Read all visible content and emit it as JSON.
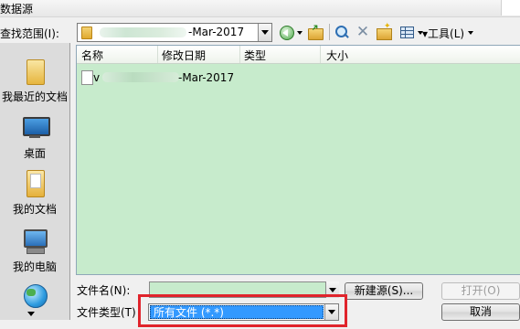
{
  "window": {
    "title": "数据源"
  },
  "lookin": {
    "label": "查找范围(I):",
    "path_suffix": "-Mar-2017"
  },
  "toolbar": {
    "tools_label": "工具(L)",
    "icons": [
      "back-icon",
      "up-folder-icon",
      "search-web-icon",
      "delete-icon",
      "new-folder-icon",
      "view-menu-icon"
    ]
  },
  "places": [
    {
      "label": "我最近的文档",
      "icon": "recent-documents-icon"
    },
    {
      "label": "桌面",
      "icon": "desktop-icon"
    },
    {
      "label": "我的文档",
      "icon": "my-documents-icon"
    },
    {
      "label": "我的电脑",
      "icon": "my-computer-icon"
    },
    {
      "label": "",
      "icon": "network-places-icon"
    }
  ],
  "filelist": {
    "columns": [
      "名称",
      "修改日期",
      "类型",
      "大小"
    ],
    "rows": [
      {
        "name_prefix": "v",
        "name_suffix": "-Mar-2017"
      }
    ]
  },
  "filename": {
    "label": "文件名(N):",
    "value": ""
  },
  "filetype": {
    "label": "文件类型(T)",
    "selected": "所有文件 (*.*)"
  },
  "buttons": {
    "new_source": "新建源(S)...",
    "open": "打开(O)",
    "cancel": "取消"
  },
  "colors": {
    "list_background": "#c7ebcc",
    "highlight": "#e0242c",
    "selection": "#3399ff"
  }
}
